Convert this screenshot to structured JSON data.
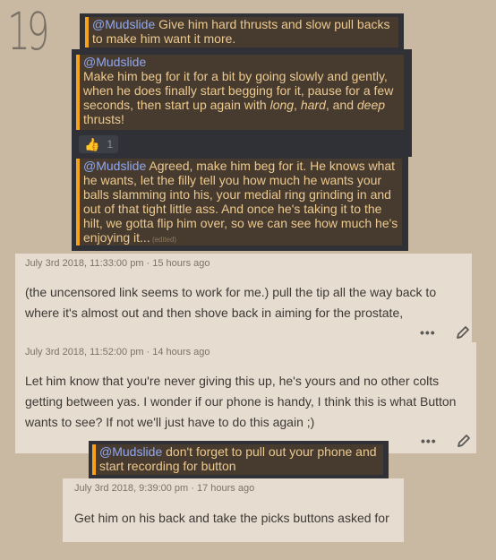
{
  "page_number": "19",
  "discord": {
    "msg1": {
      "mention": "@Mudslide",
      "text": " Give him hard thrusts and slow pull backs to make him want it more."
    },
    "msg2": {
      "mention": "@Mudslide",
      "text_a": "Make him beg for it for a bit by going slowly and gently, when he does finally start begging for it, pause for a few seconds, then start up again with ",
      "em1": "long",
      "sep1": ", ",
      "em2": "hard",
      "sep2": ", and ",
      "em3": "deep",
      "text_b": " thrusts!",
      "reaction_icon": "thumbs-up-icon",
      "reaction_count": "1"
    },
    "msg3": {
      "mention": "@Mudslide",
      "text": " Agreed, make him beg for it. He knows what he wants, let the filly tell you how much he wants your balls slamming into his, your medial ring grinding in and out of that tight little ass. And once he's taking it to the hilt, we gotta flip him over, so we can see how much he's enjoying it...",
      "edited": " (edited)"
    },
    "msg4": {
      "mention": "@Mudslide",
      "text": " don't forget to pull out your phone and start recording for button"
    }
  },
  "comments": [
    {
      "meta": "July 3rd 2018, 11:33:00 pm · 15 hours ago",
      "text": "(the uncensored link seems to work for me.) pull the tip all the way back to where it's almost out and then shove back in aiming for the prostate,",
      "more": "•••"
    },
    {
      "meta": "July 3rd 2018, 11:52:00 pm · 14 hours ago",
      "text": "Let him know that you're never giving this up, he's yours and no other colts getting between yas. I wonder if our phone is handy, I think this is what Button wants to see? If not we'll just have to do this again ;)",
      "more": "•••"
    },
    {
      "meta": "July 3rd 2018, 9:39:00 pm · 17 hours ago",
      "text": "Get him on his back and take the picks buttons asked for"
    }
  ]
}
